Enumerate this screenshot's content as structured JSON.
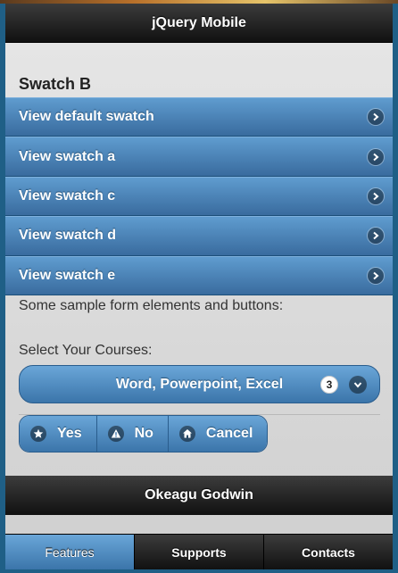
{
  "header": {
    "title": "jQuery Mobile"
  },
  "section": {
    "title": "Swatch B"
  },
  "listview": {
    "items": [
      {
        "label": "View default swatch"
      },
      {
        "label": "View swatch a"
      },
      {
        "label": "View swatch c"
      },
      {
        "label": "View swatch d"
      },
      {
        "label": "View swatch e"
      }
    ]
  },
  "content": {
    "intro": "Some sample form elements and buttons:",
    "select_label": "Select Your Courses:"
  },
  "course_select": {
    "value": "Word, Powerpoint, Excel",
    "count": "3"
  },
  "buttons": {
    "yes": {
      "label": "Yes",
      "icon": "star-icon"
    },
    "no": {
      "label": "No",
      "icon": "alert-icon"
    },
    "cancel": {
      "label": "Cancel",
      "icon": "home-icon"
    }
  },
  "footer": {
    "title": "Okeagu Godwin"
  },
  "navbar": {
    "tabs": [
      {
        "label": "Features",
        "active": true
      },
      {
        "label": "Supports",
        "active": false
      },
      {
        "label": "Contacts",
        "active": false
      }
    ]
  },
  "colors": {
    "accent": "#396b9e",
    "bar_dark": "#111111"
  }
}
